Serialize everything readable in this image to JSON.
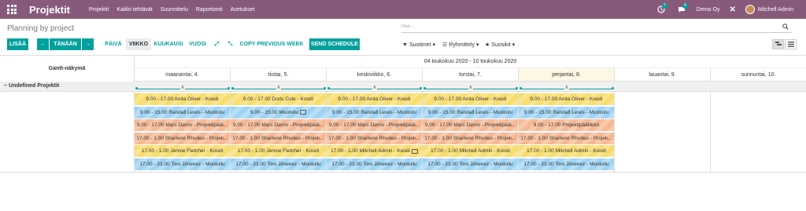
{
  "nav": {
    "brand": "Projektit",
    "menu": [
      "Projektit",
      "Kaikki tehtävät",
      "Suunnittelu",
      "Raportointi",
      "Asetukset"
    ],
    "activity_count": "7",
    "message_count": "4",
    "company": "Demo Oy",
    "user": "Mitchell Admin"
  },
  "page": {
    "title": "Planning by project",
    "search_placeholder": "Hae..."
  },
  "toolbar": {
    "add": "LISÄÄ",
    "prev": "←",
    "today": "TÄNÄÄN",
    "next": "→",
    "scales": [
      "PÄIVÄ",
      "VIIKKO",
      "KUUKAUSI",
      "VUOSI"
    ],
    "selected_scale": "VIIKKO",
    "copy_previous": "COPY PREVIOUS WEEK",
    "send": "SEND SCHEDULE"
  },
  "filters": {
    "filters": "Suotimet",
    "groupby": "Ryhmittely",
    "favorites": "Suosikit"
  },
  "gantt": {
    "row_header": "Gantt-näkymä",
    "range": "04 toukokuu 2020 - 10 toukokuu 2020",
    "days": [
      "maanantai, 4.",
      "tiistai, 5.",
      "keskiviikko, 6.",
      "torstai, 7.",
      "perjantai, 8.",
      "lauantai, 9.",
      "sunnuntai, 10."
    ],
    "today_index": 4,
    "group": "Undefined Projektit",
    "capacity": [
      "6",
      "6",
      "6",
      "6",
      "6"
    ],
    "rows": [
      {
        "color": "y",
        "cells": [
          "9.00 - 17.00 Anita Oliver - Koodi",
          "9.00 - 17.00 Doris Cole - Koodi",
          "9.00 - 17.00 Anita Oliver - Koodi",
          "9.00 - 17.00 Anita Oliver - Koodi",
          "9.00 - 17.00 Anita Oliver - Koodi"
        ]
      },
      {
        "color": "b",
        "cells": [
          "9.00 - 15.00 Randall Lewis - Muotoilu",
          "9.00 - 15.00 Muotoilu",
          "9.00 - 15.00 Randall Lewis - Muotoilu",
          "9.00 - 15.00 Randall Lewis - Muotoilu",
          "9.00 - 15.00 Randall Lewis - Muotoilu"
        ]
      },
      {
        "color": "o",
        "cells": [
          "9.00 - 17.00 Marc Demo - Projektipääl...",
          "9.00 - 17.00 Marc Demo - Projektipääl...",
          "9.00 - 17.00 Marc Demo - Projektipääl...",
          "9.00 - 17.00 Marc Demo - Projektipääl...",
          "9.00 - 17.00 Projektipäällikkö"
        ]
      },
      {
        "color": "o",
        "cells": [
          "17.00 - 1.00 Sharlene Rhodes - Projek...",
          "17.00 - 1.00 Sharlene Rhodes - Projek...",
          "17.00 - 1.00 Sharlene Rhodes - Projek...",
          "17.00 - 1.00 Sharlene Rhodes - Projek...",
          "17.00 - 1.00 Sharlene Rhodes - Projek..."
        ]
      },
      {
        "color": "y",
        "cells": [
          "17.00 - 1.00 Jennie Fletcher - Koodi",
          "17.00 - 1.00 Jennie Fletcher - Koodi",
          "17.00 - 1.00 Mitchell Admin - Koodi",
          "17.00 - 1.00 Mitchell Admin - Koodi",
          "17.00 - 1.00 Mitchell Admin - Koodi"
        ]
      },
      {
        "color": "b",
        "cells": [
          "17.00 - 23.00 Toni Jimenez - Muotoilu",
          "17.00 - 23.00 Toni Jimenez - Muotoilu",
          "17.00 - 23.00 Toni Jimenez - Muotoilu",
          "17.00 - 23.00 Toni Jimenez - Muotoilu",
          "17.00 - 23.00 Toni Jimenez - Muotoilu"
        ]
      }
    ],
    "chat_cells": [
      [
        1,
        1
      ],
      [
        4,
        2
      ]
    ]
  }
}
